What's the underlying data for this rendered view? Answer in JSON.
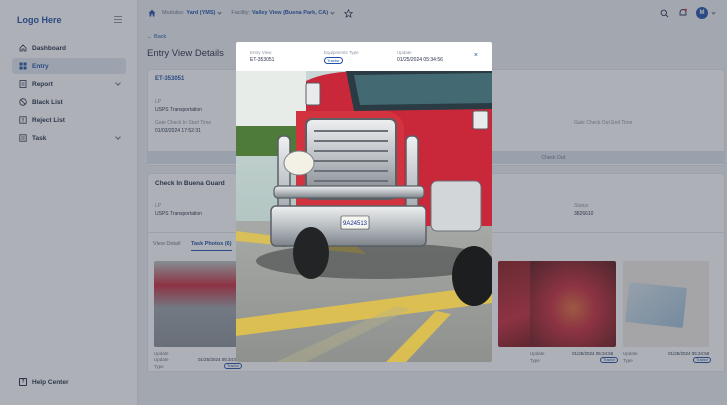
{
  "sidebar": {
    "logo": "Logo Here",
    "items": [
      {
        "label": "Dashboard",
        "icon": "home-icon",
        "active": false,
        "expandable": false
      },
      {
        "label": "Entry",
        "icon": "grid-icon",
        "active": true,
        "expandable": false
      },
      {
        "label": "Report",
        "icon": "report-icon",
        "active": false,
        "expandable": true
      },
      {
        "label": "Black List",
        "icon": "block-icon",
        "active": false,
        "expandable": false
      },
      {
        "label": "Reject List",
        "icon": "alert-icon",
        "active": false,
        "expandable": false
      },
      {
        "label": "Task",
        "icon": "task-icon",
        "active": false,
        "expandable": true
      }
    ],
    "help": "Help Center"
  },
  "topbar": {
    "module_label": "Modules:",
    "module_value": "Yard (YMS)",
    "facility_label": "Facility:",
    "facility_value": "Valley View (Buena Park, CA)",
    "avatar": "M"
  },
  "page": {
    "back": "← Back",
    "title": "Entry View Details",
    "entry_id": "ET-353051",
    "lp_label": "LP",
    "lp_value": "USPS Transportation",
    "gate_start_label": "Gate Check In Start Time",
    "gate_start_value": "01/03/2024 17:52:31",
    "gate_end_label": "Gate Check Out End Time",
    "bar_text": "Check Out",
    "checkin_title": "Check In  Buena Guard",
    "lp2_label": "LP",
    "lp2_value": "USPS Transportation",
    "status_label": "Status",
    "status_value": "3826610",
    "tabs": [
      "View Detail",
      "Task Photos (6)"
    ],
    "thumbs": [
      {
        "update_label": "Update",
        "update_value": "01/25/2024 05:34:56",
        "type_label": "Type",
        "type_value": "Tractor"
      },
      {
        "update_label": "Update",
        "update_value": "01/25/2024 05:34:56",
        "type_label": "Type",
        "type_value": "Tractor"
      },
      {
        "update_label": "Update",
        "update_value": "01/25/2024 05:34:56",
        "type_label": "Type",
        "type_value": "Tractor"
      }
    ]
  },
  "modal": {
    "entry_view_label": "Entry View",
    "entry_view_value": "ET-353051",
    "equipments_label": "Equipments Type",
    "equipments_value": "Tractor",
    "update_label": "Update",
    "update_value": "01/25/2024 05:34:56",
    "close": "×"
  },
  "colors": {
    "accent": "#1f4fa8",
    "truck_red": "#c8283a",
    "parking_yellow": "#e2c34a"
  }
}
